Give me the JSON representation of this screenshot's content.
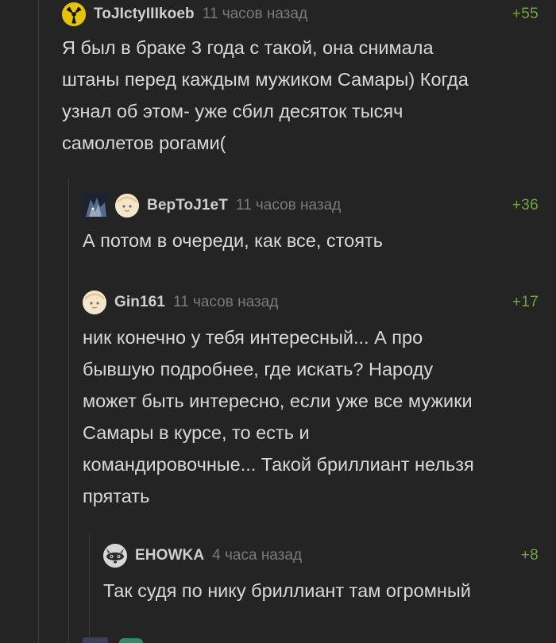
{
  "comments": [
    {
      "username": "ToJIctyIIIkoeb",
      "time": "11 часов назад",
      "rating": "+55",
      "text": "Я был в браке 3 года с такой, она снимала\nштаны перед каждым мужиком Самары) Когда\nузнал об этом- уже сбил десяток тысяч\nсамолетов рогами(",
      "avatar": "radiation-icon"
    },
    {
      "username": "BepToJ1eT",
      "time": "11 часов назад",
      "rating": "+36",
      "text": "А потом в очереди, как все, стоять",
      "avatar": "anime-face-icon"
    },
    {
      "username": "Gin161",
      "time": "11 часов назад",
      "rating": "+17",
      "text": "ник конечно у тебя интересный... А про\nбывшую подробнее, где искать? Народу\nможет быть интересно, если уже все мужики\nСамары в курсе, то есть и\nкомандировочные... Такой бриллиант нельзя\nпрятать",
      "avatar": "anime-face-icon"
    },
    {
      "username": "EHOWKA",
      "time": "4 часа назад",
      "rating": "+8",
      "text": "Так судя по нику бриллиант там огромный",
      "avatar": "raccoon-icon"
    }
  ],
  "colors": {
    "background": "#242424",
    "rating": "#6fa53e",
    "username": "#cfcfcf",
    "time": "#7a7a7a",
    "text": "#d8d8d8",
    "thread_line": "#3c3c3c"
  }
}
